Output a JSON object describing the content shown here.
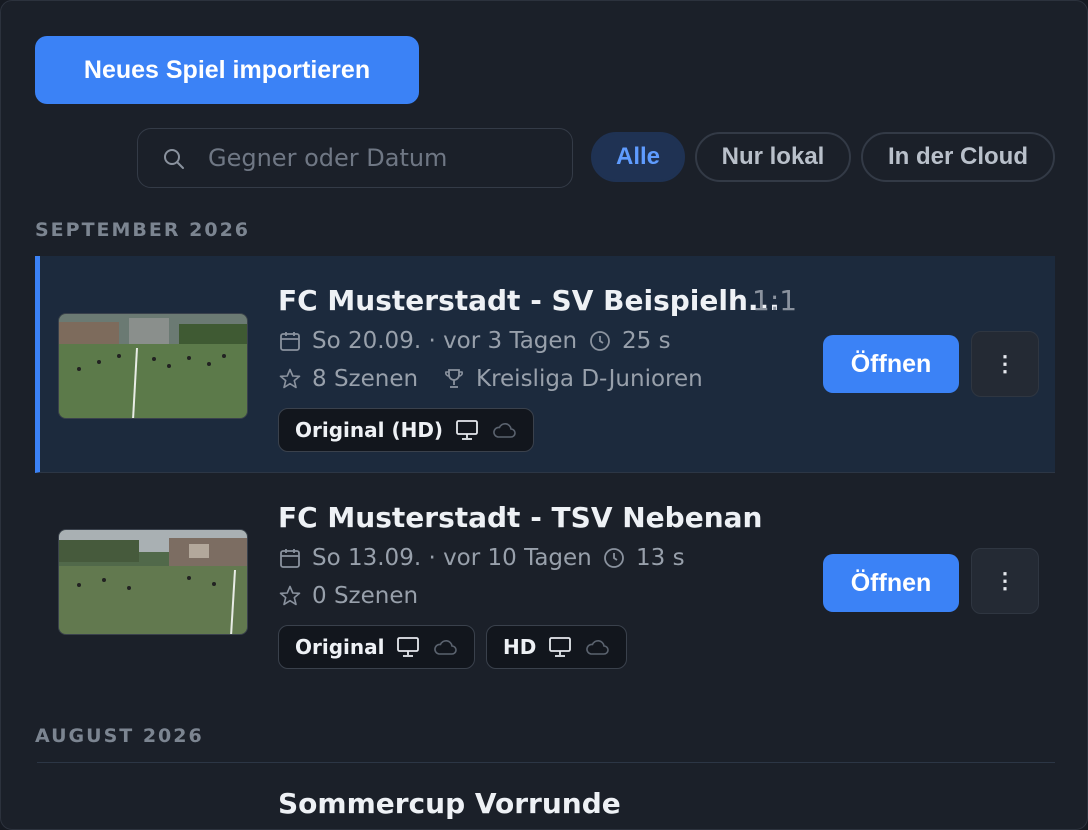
{
  "toolbar": {
    "import_label": "Neues Spiel importieren"
  },
  "search": {
    "placeholder": "Gegner oder Datum",
    "value": ""
  },
  "filters": [
    {
      "label": "Alle",
      "active": true
    },
    {
      "label": "Nur lokal",
      "active": false
    },
    {
      "label": "In der Cloud",
      "active": false
    }
  ],
  "sections": [
    {
      "heading": "SEPTEMBER 2026",
      "games": [
        {
          "title": "FC Musterstadt - SV Beispielh...",
          "score": "1:1",
          "date": "So 20.09. · vor 3 Tagen",
          "duration": "25 s",
          "scenes": "8 Szenen",
          "league": "Kreisliga D-Junioren",
          "badges": [
            {
              "label": "Original (HD)",
              "local_icon": "monitor-icon",
              "cloud_icon": "cloud-icon"
            }
          ],
          "open_label": "Öffnen",
          "more_label": "⋮",
          "selected": true
        },
        {
          "title": "FC Musterstadt - TSV Nebenan",
          "score": "",
          "date": "So 13.09. · vor 10 Tagen",
          "duration": "13 s",
          "scenes": "0 Szenen",
          "league": "",
          "badges": [
            {
              "label": "Original",
              "local_icon": "monitor-icon",
              "cloud_icon": "cloud-icon"
            },
            {
              "label": "HD",
              "local_icon": "monitor-icon",
              "cloud_icon": "cloud-icon"
            }
          ],
          "open_label": "Öffnen",
          "more_label": "⋮",
          "selected": false
        }
      ]
    },
    {
      "heading": "AUGUST 2026",
      "games": [
        {
          "title": "Sommercup Vorrunde"
        }
      ]
    }
  ],
  "colors": {
    "accent": "#3b82f6",
    "panel": "#1b2029",
    "selected_row": "#1c2a3d"
  }
}
